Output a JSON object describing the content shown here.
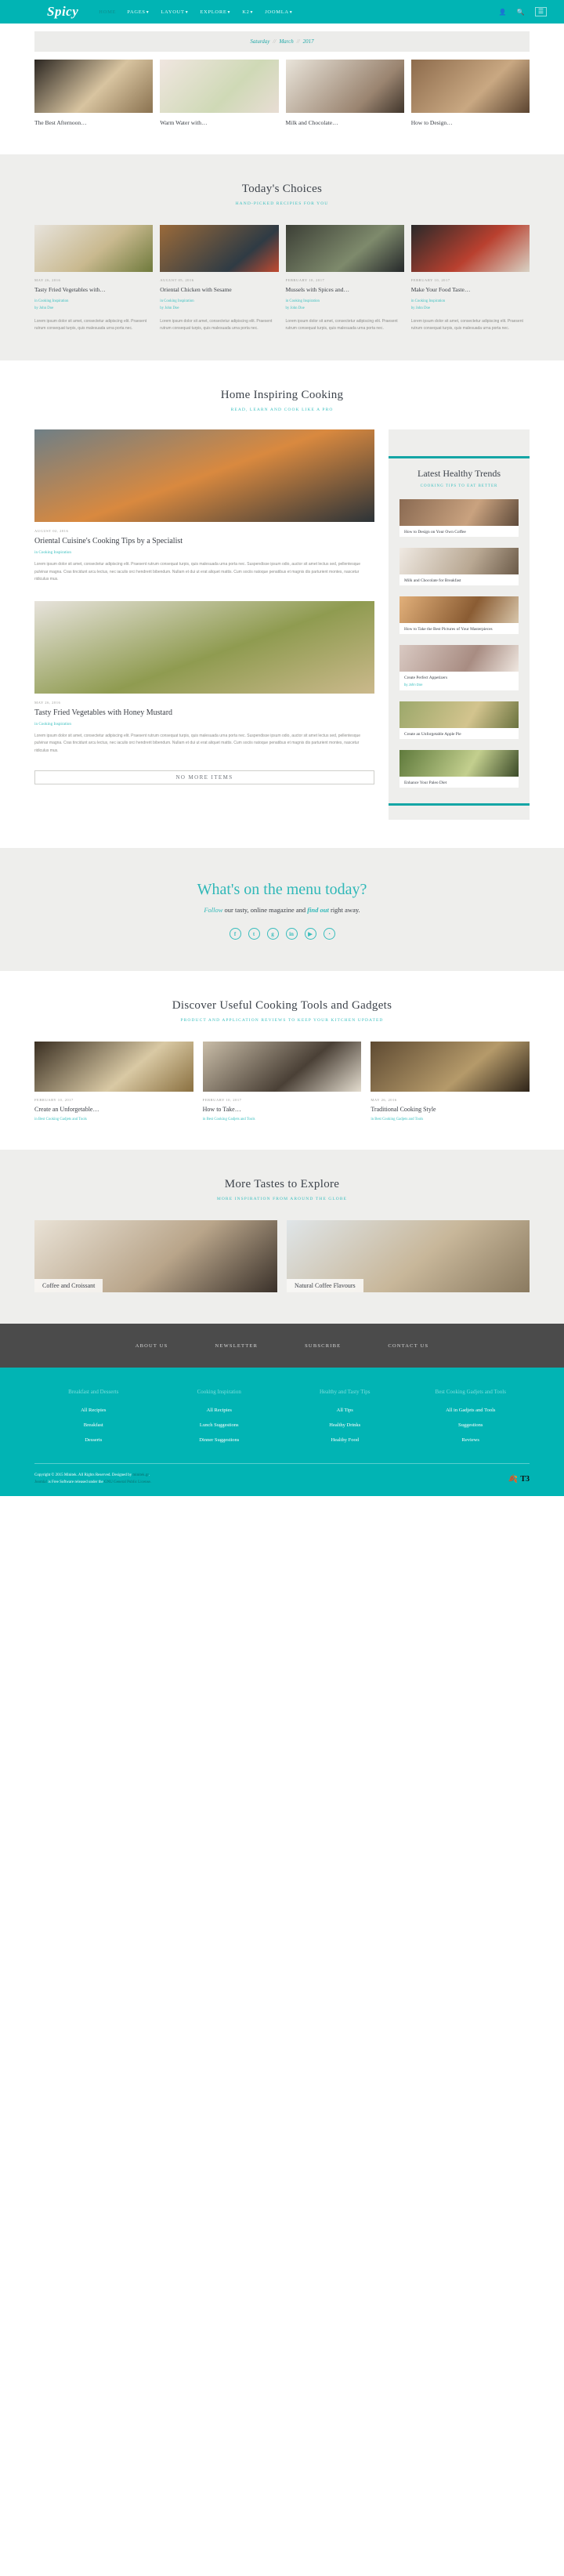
{
  "header": {
    "brand": "Spicy",
    "nav": [
      {
        "label": "HOME",
        "caret": false,
        "active": true
      },
      {
        "label": "PAGES",
        "caret": true,
        "active": false
      },
      {
        "label": "LAYOUT",
        "caret": true,
        "active": false
      },
      {
        "label": "EXPLORE",
        "caret": true,
        "active": false
      },
      {
        "label": "K2",
        "caret": true,
        "active": false
      },
      {
        "label": "JOOMLA",
        "caret": true,
        "active": false
      }
    ],
    "icons": [
      {
        "name": "user-icon",
        "glyph": "●"
      },
      {
        "name": "search-icon",
        "glyph": "⌕"
      },
      {
        "name": "hamburger-icon",
        "glyph": "☰"
      }
    ]
  },
  "datebar": {
    "weekday": "Saturday",
    "separator": "//",
    "month": "March",
    "year": "2017"
  },
  "featured": [
    {
      "title": "The Best Afternoon…",
      "img": "1"
    },
    {
      "title": "Warm Water with…",
      "img": "2"
    },
    {
      "title": "Milk and Chocolate…",
      "img": "3"
    },
    {
      "title": "How to Design…",
      "img": "4"
    }
  ],
  "todays_choices": {
    "title": "Today's Choices",
    "subtitle": "HAND-PICKED RECIPIES FOR YOU",
    "cards": [
      {
        "date": "MAY 26, 2016",
        "title": "Tasty Fried Vegetables with…",
        "category": "in Cooking Inspiration",
        "author": "by John Doe",
        "excerpt": "Lorem ipsum dolor sit amet, consectetur adipiscing elit. Praesent rutrum consequat turpis, quis malesuada urna porta nec."
      },
      {
        "date": "AUGUST 05, 2016",
        "title": "Oriental Chicken with Sesame",
        "category": "in Cooking Inspiration",
        "author": "by John Doe",
        "excerpt": "Lorem ipsum dolor sit amet, consectetur adipiscing elit. Praesent rutrum consequat turpis, quis malesuada urna porta nec."
      },
      {
        "date": "FEBRUARY 10, 2017",
        "title": "Mussels with Spices and…",
        "category": "in Cooking Inspiration",
        "author": "by John Doe",
        "excerpt": "Lorem ipsum dolor sit amet, consectetur adipiscing elit. Praesent rutrum consequat turpis, quis malesuada urna porta nec."
      },
      {
        "date": "FEBRUARY 10, 2017",
        "title": "Make Your Food Taste…",
        "category": "in Cooking Inspiration",
        "author": "by John Doe",
        "excerpt": "Lorem ipsum dolor sit amet, consectetur adipiscing elit. Praesent rutrum consequat turpis, quis malesuada urna porta nec."
      }
    ]
  },
  "inspiring": {
    "title": "Home Inspiring Cooking",
    "subtitle": "READ, LEARN AND COOK LIKE A PRO",
    "posts": [
      {
        "date": "AUGUST 02, 2016",
        "title": "Oriental Cuisine's Cooking Tips by a Specialist",
        "category": "in Cooking Inspiration",
        "body": "Lorem ipsum dolor sit amet, consectetur adipiscing elit. Praesent rutrum consequat turpis, quis malesuada urna porta nec. Suspendisse ipsum odio, auctor sit amet lectus sed, pellentesque pulvinar magna. Cras tincidunt arcu lectus, nec iaculis orci hendrerit bibendum. Nullam et dui ut erat aliquet mattis. Cum sociis natoque penatibus et magnis dis parturient montes, nascetur ridiculus mus."
      },
      {
        "date": "MAY 26, 2016",
        "title": "Tasty Fried Vegetables with Honey Mustard",
        "category": "in Cooking Inspiration",
        "body": "Lorem ipsum dolor sit amet, consectetur adipiscing elit. Praesent rutrum consequat turpis, quis malesuada urna porta nec. Suspendisse ipsum odio, auctor sit amet lectus sed, pellentesque pulvinar magna. Cras tincidunt arcu lectus, nec iaculis orci hendrerit bibendum. Nullam et dui ut erat aliquet mattis. Cum sociis natoque penatibus et magnis dis parturient montes, nascetur ridiculus mus."
      }
    ],
    "no_more_items": "NO MORE ITEMS"
  },
  "sidebar": {
    "title": "Latest Healthy Trends",
    "subtitle": "COOKING TIPS TO EAT BETTER",
    "items": [
      {
        "title": "How to Design on Your Own Coffee",
        "sub": ""
      },
      {
        "title": "Milk and Chocolate for Breakfast",
        "sub": ""
      },
      {
        "title": "How to Take the Best Pictures of Your Masterpieces",
        "sub": ""
      },
      {
        "title": "Create Perfect Appetizers",
        "sub": "by John Doe"
      },
      {
        "title": "Create an Unforgetable Apple Pie",
        "sub": ""
      },
      {
        "title": "Enhance Your Paleo Diet",
        "sub": ""
      }
    ]
  },
  "menu_today": {
    "title": "What's on the menu today?",
    "tagline_1": "Follow",
    "tagline_2": "our tasty, online magazine and",
    "tagline_3": "find out",
    "tagline_4": "right away.",
    "socials": [
      {
        "name": "facebook-icon",
        "glyph": "f"
      },
      {
        "name": "twitter-icon",
        "glyph": "t"
      },
      {
        "name": "google-plus-icon",
        "glyph": "g"
      },
      {
        "name": "linkedin-icon",
        "glyph": "in"
      },
      {
        "name": "youtube-icon",
        "glyph": "▶"
      },
      {
        "name": "rss-icon",
        "glyph": "◔"
      }
    ]
  },
  "tools": {
    "title": "Discover Useful Cooking Tools and Gadgets",
    "subtitle": "PRODUCT AND APPLICATION REVIEWS TO KEEP YOUR KITCHEN UPDATED",
    "cards": [
      {
        "date": "FEBRUARY 10, 2017",
        "title": "Create an Unforgetable…",
        "category": "in Best Cooking Gadjets and Tools"
      },
      {
        "date": "FEBRUARY 10, 2017",
        "title": "How to Take…",
        "category": "in Best Cooking Gadjets and Tools"
      },
      {
        "date": "MAY 26, 2016",
        "title": "Traditional Cooking Style",
        "category": "in Best Cooking Gadjets and Tools"
      }
    ]
  },
  "tastes": {
    "title": "More Tastes to Explore",
    "subtitle": "MORE INSPIRATION FROM AROUND THE GLOBE",
    "cards": [
      {
        "label": "Coffee and Croissant"
      },
      {
        "label": "Natural Coffee Flavours"
      }
    ]
  },
  "footer": {
    "top_links": [
      "ABOUT US",
      "NEWSLETTER",
      "SUBSCRIBE",
      "CONTACT US"
    ],
    "columns": [
      {
        "heading": "Breakfast and Desserts",
        "links": [
          "All Recipies",
          "Breakfast",
          "Desserts"
        ]
      },
      {
        "heading": "Cooking Inspiration",
        "links": [
          "All Recipies",
          "Lunch Suggestions",
          "Dinner Suggestions"
        ]
      },
      {
        "heading": "Healthy and Tasty Tips",
        "links": [
          "All Tips",
          "Healthy Drinks",
          "Healthy Food"
        ]
      },
      {
        "heading": "Best Cooking Gadjets and Tools",
        "links": [
          "All in Gadjets and Tools",
          "Suggestions",
          "Reviews"
        ]
      }
    ],
    "copyright_line_1": "Copyright © 2015 Minitek. All Rights Reserved. Designed by",
    "copyright_link_1": "minitek.gr",
    "copyright_line_2a": "Joomla!",
    "copyright_line_2b": "is Free Software released under the",
    "copyright_link_2": "GNU General Public License.",
    "t3_label": "T3"
  }
}
